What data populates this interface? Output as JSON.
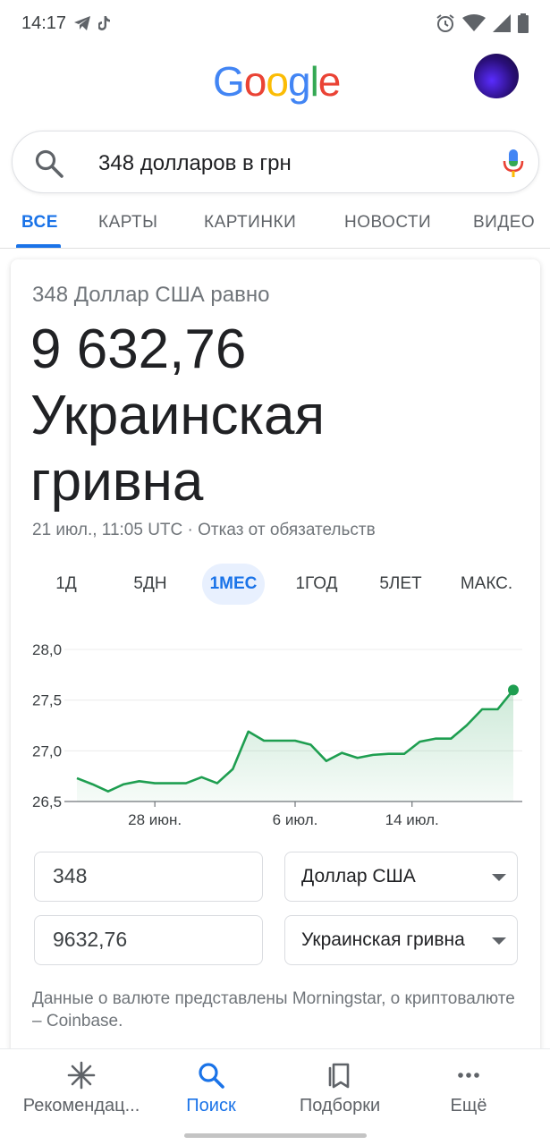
{
  "status_bar": {
    "time": "14:17"
  },
  "search": {
    "query": "348 долларов в грн"
  },
  "tabs": [
    "ВСЕ",
    "КАРТЫ",
    "КАРТИНКИ",
    "НОВОСТИ",
    "ВИДЕО"
  ],
  "converter": {
    "equals_text": "348 Доллар США равно",
    "result_amount": "9 632,76",
    "result_currency_line1": "Украинская",
    "result_currency_line2": "гривна",
    "timestamp": "21 июл., 11:05 UTC · Отказ от обязательств",
    "ranges": [
      "1Д",
      "5ДН",
      "1МЕС",
      "1ГОД",
      "5ЛЕТ",
      "МАКС."
    ],
    "from_amount": "348",
    "from_currency": "Доллар США",
    "to_amount": "9632,76",
    "to_currency": "Украинская гривна",
    "source_text": "Данные о валюте представлены Morningstar, о криптовалюте – Coinbase."
  },
  "colors": {
    "accent": "#1a73e8",
    "chart_line": "#1e9e50"
  },
  "chart_data": {
    "type": "area",
    "y_ticks": [
      "28,0",
      "27,5",
      "27,0",
      "26,5"
    ],
    "x_ticks": [
      "28 июн.",
      "6 июл.",
      "14 июл."
    ],
    "ylim": [
      26.5,
      28.0
    ],
    "x": [
      0,
      1,
      2,
      3,
      4,
      5,
      6,
      7,
      8,
      9,
      10,
      11,
      12,
      13,
      14,
      15,
      16,
      17,
      18,
      19,
      20,
      21,
      22,
      23,
      24,
      25,
      26,
      27,
      28
    ],
    "values": [
      26.73,
      26.67,
      26.6,
      26.67,
      26.7,
      26.68,
      26.68,
      26.68,
      26.74,
      26.68,
      26.82,
      27.19,
      27.1,
      27.1,
      27.1,
      27.06,
      26.9,
      26.98,
      26.93,
      26.96,
      26.97,
      26.97,
      27.09,
      27.12,
      27.12,
      27.25,
      27.41,
      27.41,
      27.6
    ],
    "x_tick_positions": [
      5,
      14,
      21.5
    ]
  },
  "bottom_nav": [
    "Рекомендац...",
    "Поиск",
    "Подборки",
    "Ещё"
  ]
}
